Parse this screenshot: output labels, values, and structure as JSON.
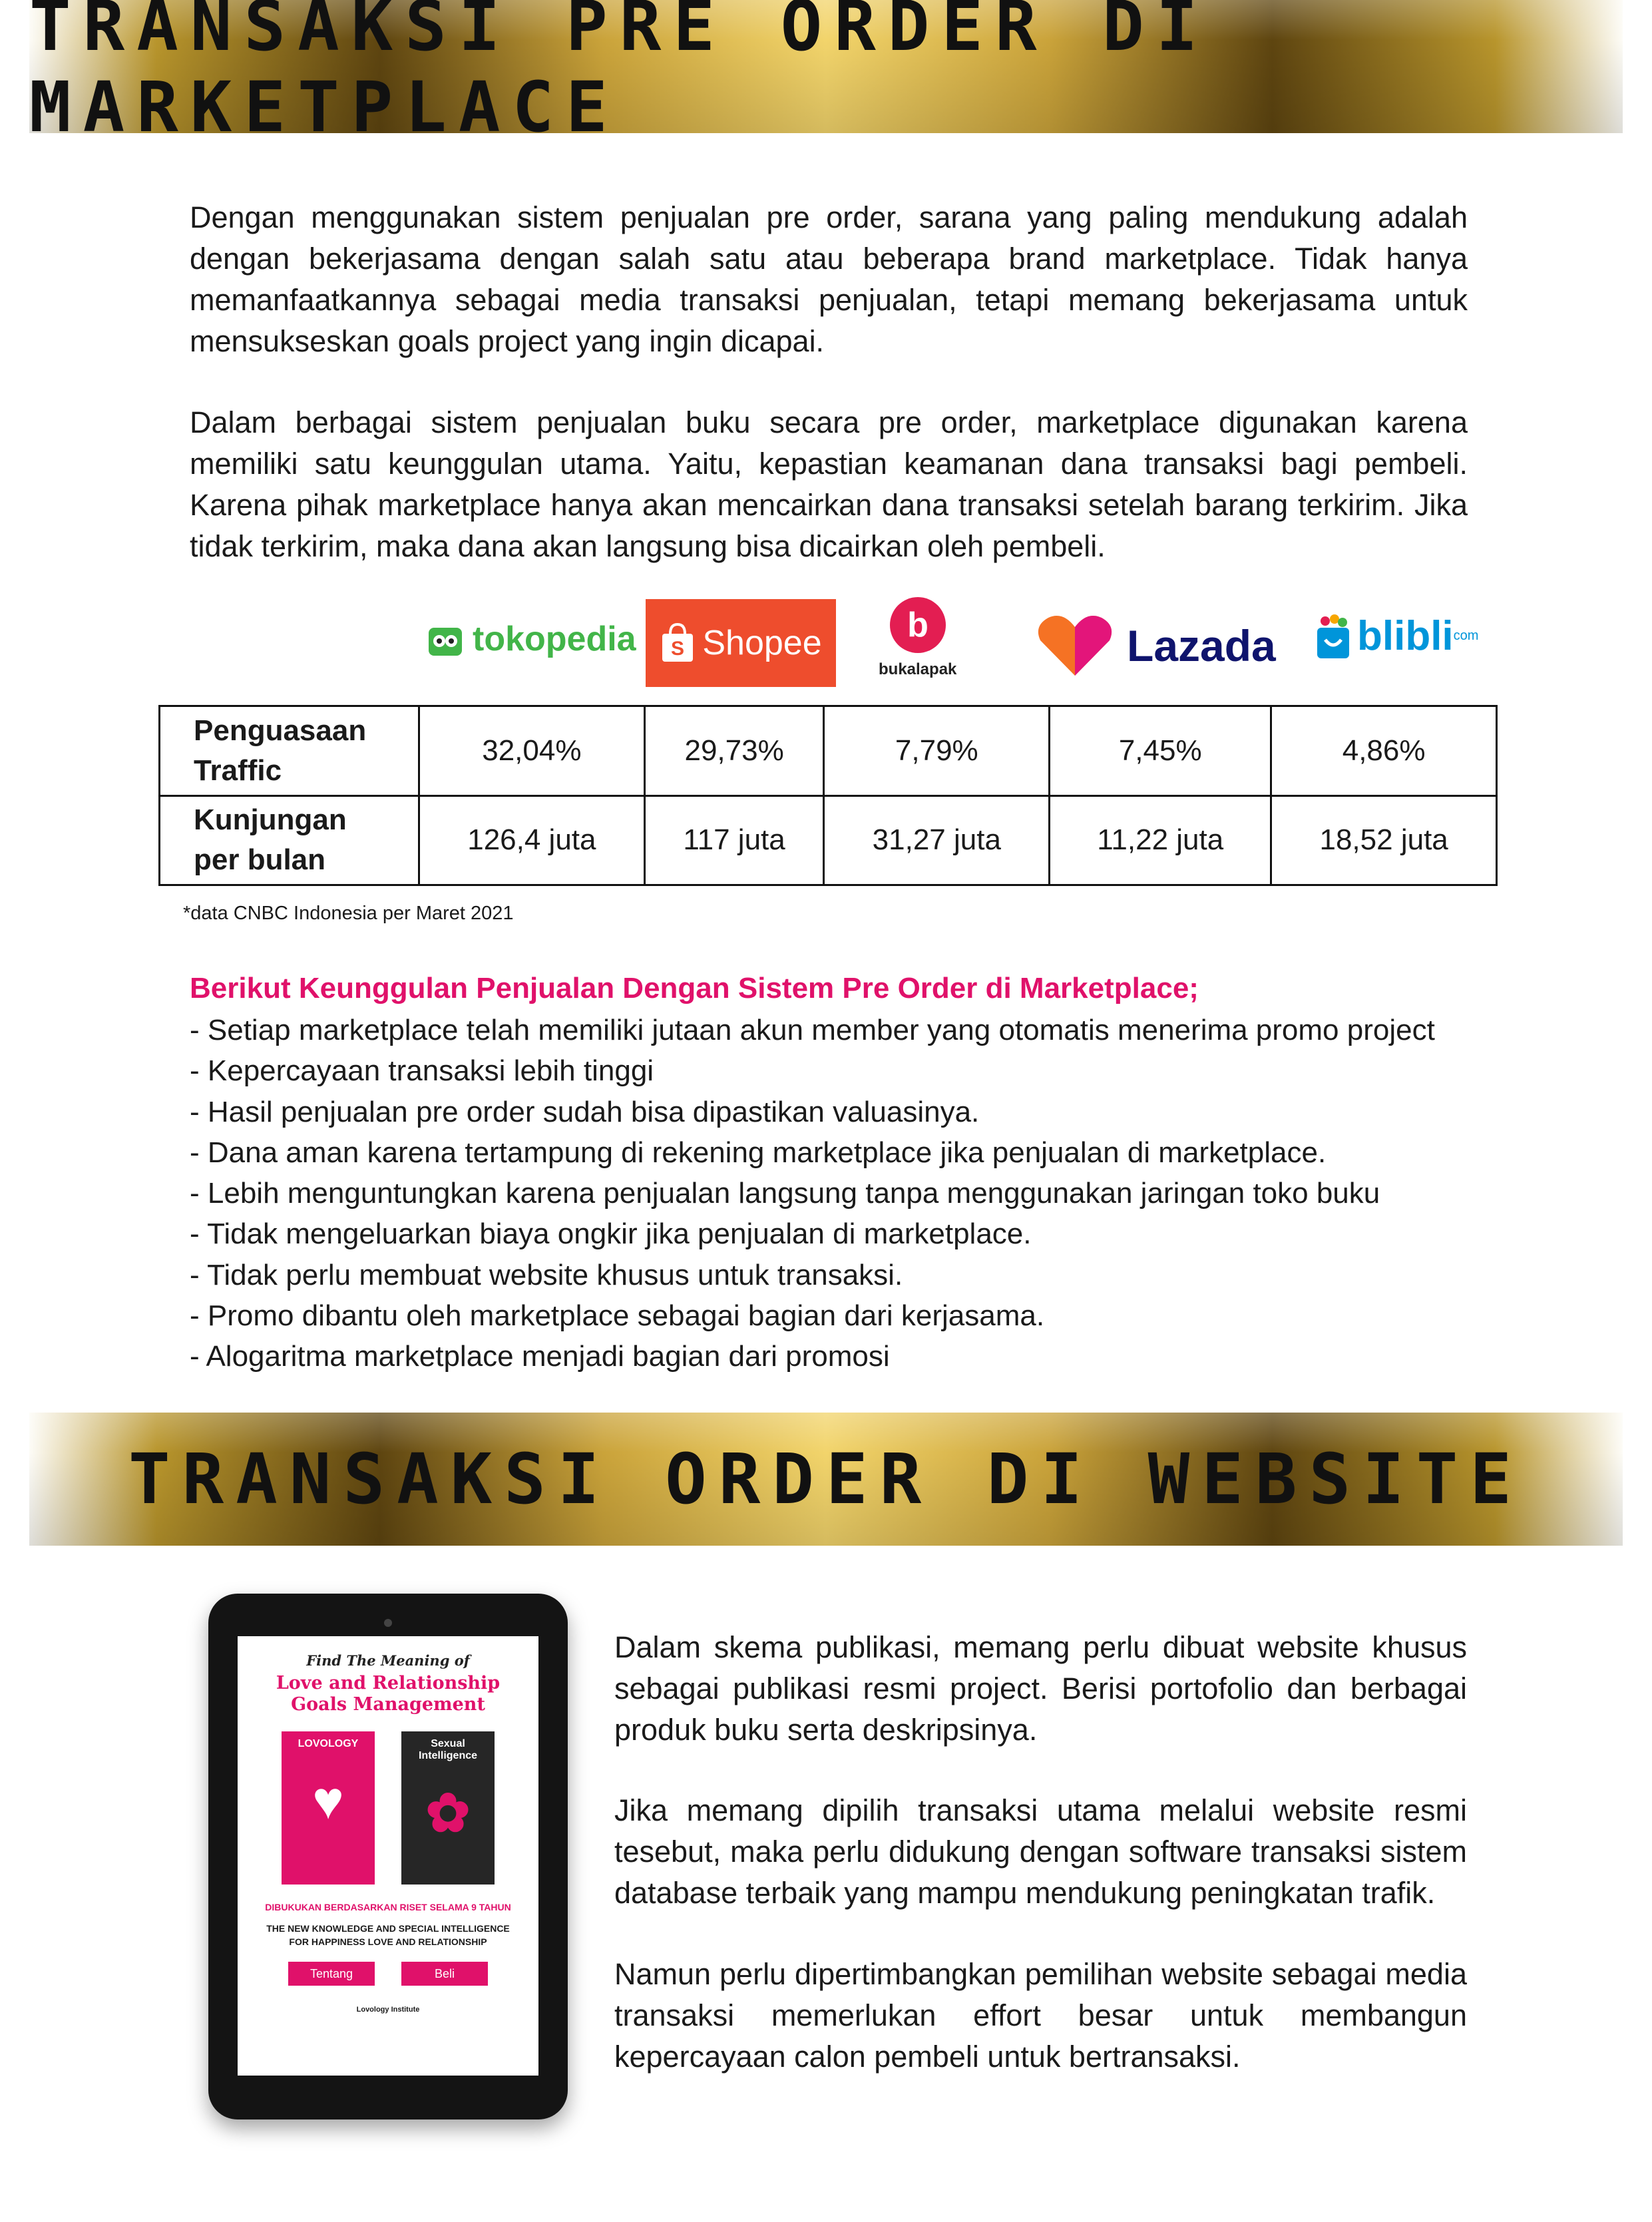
{
  "banner1": {
    "title": "TRANSAKSI PRE ORDER DI MARKETPLACE"
  },
  "intro": {
    "p1": "Dengan menggunakan sistem penjualan pre order, sarana yang paling mendukung adalah dengan bekerjasama dengan salah satu atau beberapa brand marketplace. Tidak hanya memanfaatkannya sebagai media transaksi penjualan, tetapi memang bekerjasama untuk mensukseskan goals project yang ingin dicapai.",
    "p2": "Dalam berbagai sistem penjualan buku secara pre order, marketplace digunakan karena memiliki satu keunggulan utama. Yaitu, kepastian keamanan dana transaksi bagi pembeli. Karena pihak marketplace hanya akan mencairkan dana transaksi setelah barang terkirim. Jika tidak terkirim, maka dana akan langsung bisa dicairkan oleh pembeli."
  },
  "logos": {
    "tokopedia": "tokopedia",
    "shopee": "Shopee",
    "bukalapak": "bukalapak",
    "lazada": "Lazada",
    "blibli": "blibli",
    "blibli_sup": "com"
  },
  "table": {
    "rows": [
      {
        "label_line1": "Penguasaan",
        "label_line2": "Traffic",
        "values": [
          "32,04%",
          "29,73%",
          "7,79%",
          "7,45%",
          "4,86%"
        ]
      },
      {
        "label_line1": "Kunjungan",
        "label_line2": "per bulan",
        "values": [
          "126,4 juta",
          "117 juta",
          "31,27 juta",
          "11,22 juta",
          "18,52 juta"
        ]
      }
    ]
  },
  "note": "*data CNBC Indonesia per Maret 2021",
  "advantages": {
    "title": "Berikut Keunggulan Penjualan Dengan Sistem Pre Order di Marketplace;",
    "items": [
      "- Setiap marketplace telah memiliki jutaan akun member yang otomatis menerima promo project",
      "- Kepercayaan transaksi lebih tinggi",
      "- Hasil penjualan pre order sudah bisa dipastikan valuasinya.",
      "- Dana aman karena tertampung di rekening marketplace jika penjualan di marketplace.",
      "- Lebih menguntungkan karena penjualan langsung tanpa menggunakan jaringan toko buku",
      "- Tidak mengeluarkan biaya ongkir jika penjualan di marketplace.",
      "- Tidak perlu membuat website khusus untuk transaksi.",
      "- Promo dibantu oleh marketplace sebagai bagian dari kerjasama.",
      "- Alogaritma marketplace menjadi bagian dari promosi"
    ]
  },
  "banner2": {
    "title": "TRANSAKSI ORDER DI WEBSITE"
  },
  "tablet": {
    "find": "Find The Meaning of",
    "title_line1": "Love and Relationship",
    "title_line2": "Goals Management",
    "book1": "LOVOLOGY",
    "book2_line1": "Sexual",
    "book2_line2": "Intelligence",
    "riset": "DIBUKUKAN BERDASARKAN RISET SELAMA 9 TAHUN",
    "knowledge_line1": "THE NEW KNOWLEDGE AND SPECIAL INTELLIGENCE",
    "knowledge_line2": "FOR HAPPINESS LOVE AND RELATIONSHIP",
    "btn_tentang": "Tentang",
    "btn_beli": "Beli",
    "institute": "Lovology Institute"
  },
  "website": {
    "p1": "Dalam skema publikasi, memang perlu dibuat website khusus sebagai publikasi resmi project. Berisi portofolio dan berbagai produk buku serta deskripsinya.",
    "p2": "Jika memang dipilih transaksi utama melalui website resmi tesebut, maka perlu didukung dengan software transaksi sistem database terbaik yang mampu mendukung peningkatan trafik.",
    "p3": "Namun perlu dipertimbangkan pemilihan website sebagai media transaksi memerlukan effort besar untuk membangun kepercayaan calon pembeli untuk bertransaksi."
  },
  "colors": {
    "accent_pink": "#e0116a",
    "gold": "#caa33a"
  }
}
